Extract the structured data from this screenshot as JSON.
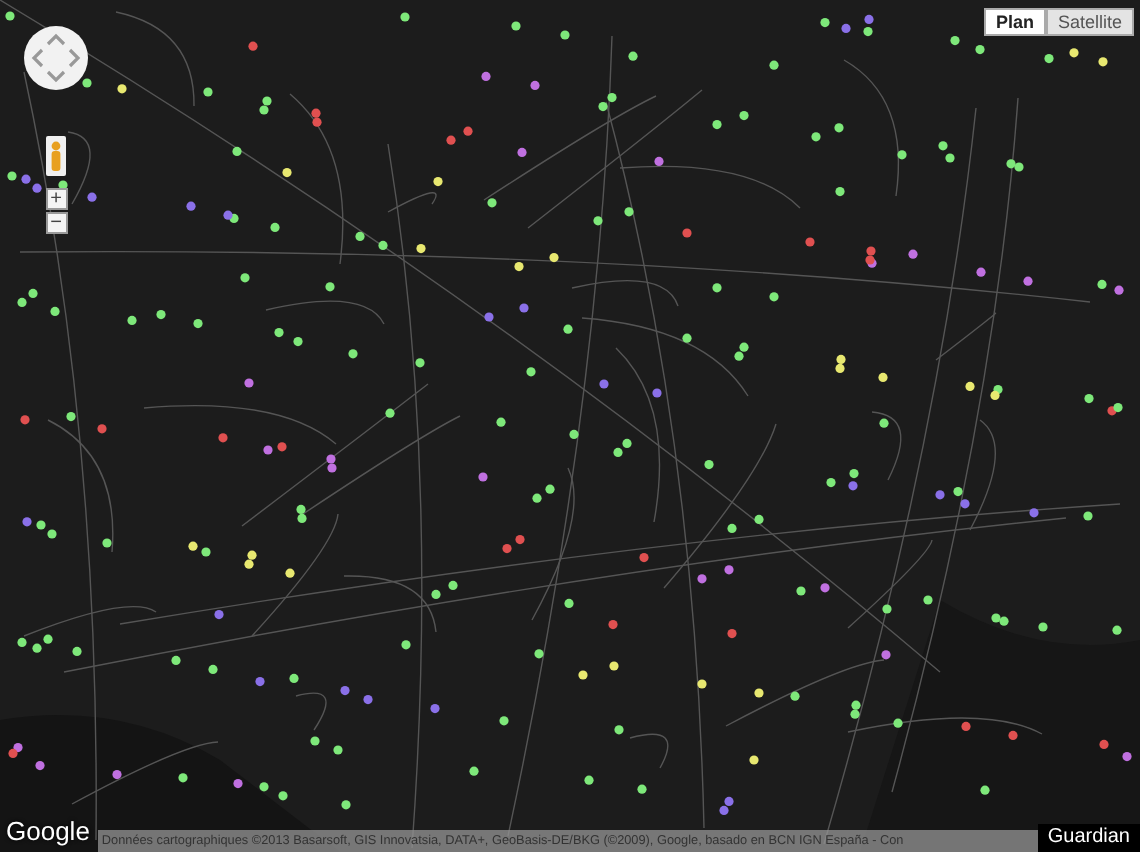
{
  "map_type_buttons": [
    {
      "label": "Plan",
      "selected": true
    },
    {
      "label": "Satellite",
      "selected": false
    }
  ],
  "zoom_controls": {
    "zoom_in": "+",
    "zoom_out": "−"
  },
  "logo": "Google",
  "attribution": "Données cartographiques ©2013 Basarsoft, GIS Innovatsia, DATA+, GeoBasis-DE/BKG (©2009), Google, basado en BCN IGN España - Con",
  "source_label": "Guardian"
}
